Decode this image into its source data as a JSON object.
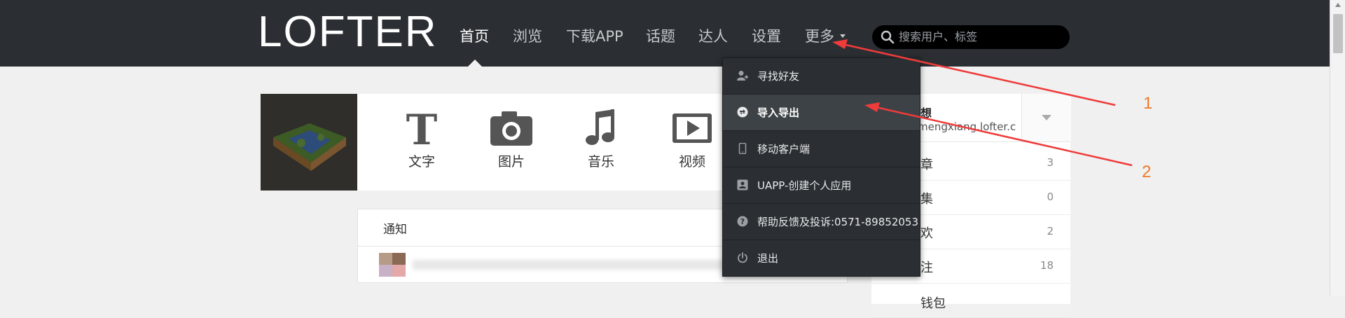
{
  "app": {
    "logo": "LOFTER"
  },
  "nav": {
    "items": [
      "首页",
      "浏览",
      "下载APP",
      "话题",
      "达人",
      "设置",
      "更多"
    ],
    "active": "首页"
  },
  "search": {
    "placeholder": "搜索用户、标签"
  },
  "post_types": [
    {
      "label": "文字",
      "icon": "text-icon"
    },
    {
      "label": "图片",
      "icon": "camera-icon"
    },
    {
      "label": "音乐",
      "icon": "music-icon"
    },
    {
      "label": "视频",
      "icon": "video-icon"
    }
  ],
  "notice": {
    "title": "通知"
  },
  "sidebar": {
    "name": "想",
    "url": "mengxiang.lofter.c",
    "rows": [
      {
        "label": "章",
        "count": "3"
      },
      {
        "label": "集",
        "count": "0"
      },
      {
        "label": "欢",
        "count": "2"
      },
      {
        "label": "注",
        "count": "18"
      },
      {
        "label": "钱包",
        "count": ""
      }
    ]
  },
  "more_menu": {
    "items": [
      {
        "label": "寻找好友",
        "icon": "add-friend-icon"
      },
      {
        "label": "导入导出",
        "icon": "import-export-icon",
        "highlighted": true
      },
      {
        "label": "移动客户端",
        "icon": "mobile-icon"
      },
      {
        "label": "UAPP-创建个人应用",
        "icon": "uapp-icon"
      },
      {
        "label": "帮助反馈及投诉:0571-89852053",
        "icon": "help-icon"
      },
      {
        "label": "退出",
        "icon": "power-icon"
      }
    ]
  },
  "annotations": {
    "label_1": "1",
    "label_2": "2",
    "color": "#ef3b3b",
    "number_color": "#ef7a29"
  },
  "colors": {
    "topbar": "#2b2f33",
    "page_bg": "#f0f0f0",
    "menu_highlight": "#3d4247"
  }
}
